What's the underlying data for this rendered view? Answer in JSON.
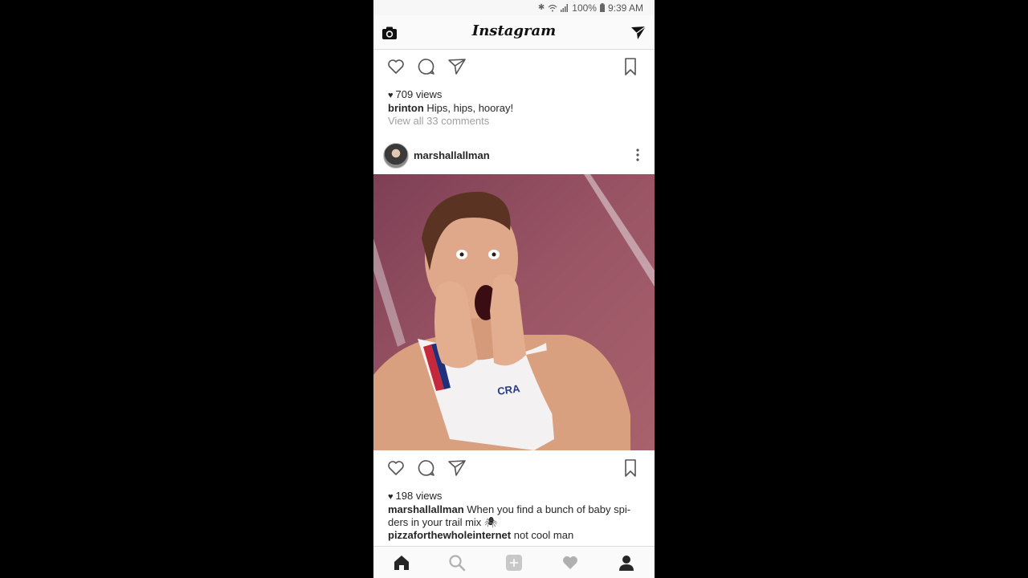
{
  "status_bar": {
    "icons": [
      "bluetooth-icon",
      "wifi-icon",
      "signal-icon",
      "battery-icon"
    ],
    "battery": "100%",
    "time": "9:39 AM"
  },
  "header": {
    "title": "Instagram",
    "left_icon": "camera-icon",
    "right_icon": "direct-message-icon"
  },
  "posts": [
    {
      "views": "709 views",
      "caption_user": "brinton",
      "caption_text": "Hips, hips, hooray!",
      "view_comments": "View all 33 comments"
    },
    {
      "username": "marshallallman",
      "views": "198 views",
      "caption_user": "marshallallman",
      "caption_text_line1": "When you find a bunch of baby spi-",
      "caption_text_line2": "ders in your trail mix 🕷",
      "comment_user": "pizzaforthewholeinternet",
      "comment_text": "not cool man"
    }
  ],
  "nav": [
    "home-icon",
    "search-icon",
    "add-post-icon",
    "activity-icon",
    "profile-icon"
  ],
  "colors": {
    "text": "#262626",
    "muted": "#a0a0a0",
    "border": "#dbdbdb",
    "nav_active": "#262626",
    "nav_inactive": "#b0b0b0"
  }
}
